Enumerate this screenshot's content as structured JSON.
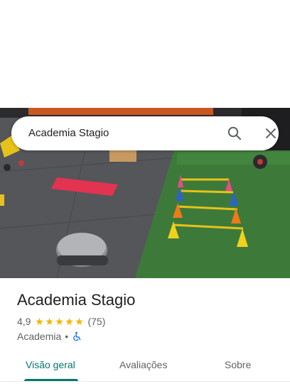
{
  "search": {
    "query": "Academia Stagio",
    "search_icon": "search-icon",
    "close_icon": "close-icon"
  },
  "photo": {
    "description_icon": "place-photo"
  },
  "place": {
    "name": "Academia Stagio",
    "rating": "4,9",
    "stars": 5,
    "review_count": "(75)",
    "category": "Academia",
    "separator": "•",
    "accessibility_icon": "wheelchair-icon"
  },
  "tabs": [
    {
      "label": "Visão geral",
      "active": true
    },
    {
      "label": "Avaliações",
      "active": false
    },
    {
      "label": "Sobre",
      "active": false
    }
  ],
  "colors": {
    "accent": "#00796b",
    "star": "#f4b400",
    "secondary_text": "#5f6368"
  }
}
